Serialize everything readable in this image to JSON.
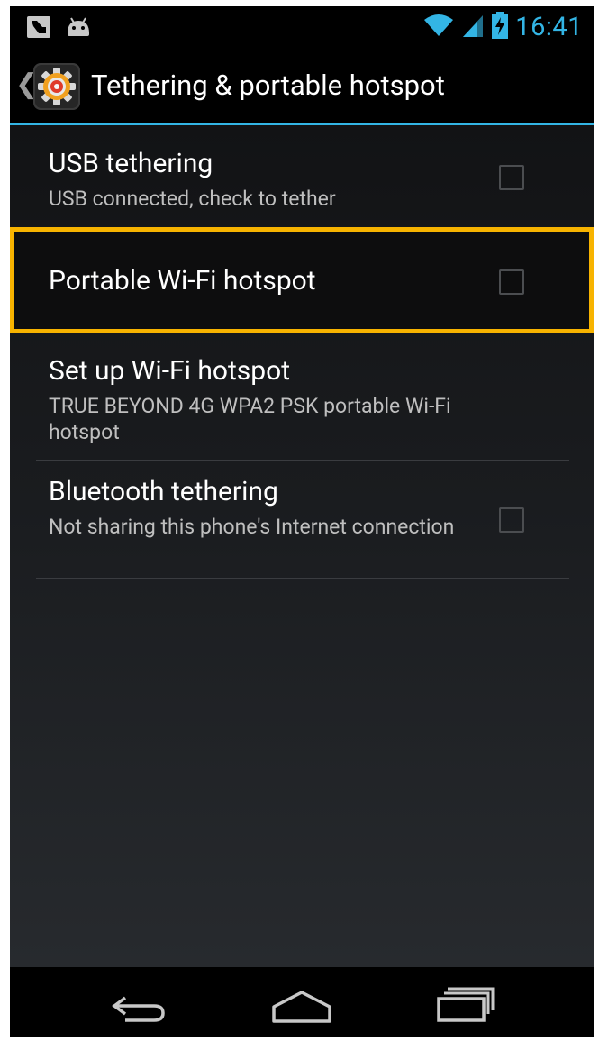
{
  "status_bar": {
    "time": "16:41",
    "icons": [
      "usb-debug-icon",
      "android-icon",
      "wifi-icon",
      "signal-icon",
      "battery-charging-icon"
    ]
  },
  "action_bar": {
    "title": "Tethering & portable hotspot",
    "up_glyph": "❮"
  },
  "preferences": [
    {
      "title": "USB tethering",
      "summary": "USB connected, check to tether",
      "checked": false
    },
    {
      "title": "Portable Wi-Fi hotspot",
      "summary": "",
      "checked": false
    },
    {
      "title": "Set up Wi-Fi hotspot",
      "summary": "TRUE BEYOND 4G WPA2 PSK portable Wi-Fi hotspot"
    },
    {
      "title": "Bluetooth tethering",
      "summary": "Not sharing this phone's Internet connection",
      "checked": false
    }
  ],
  "colors": {
    "accent": "#33b5e5",
    "highlight": "#f7b300"
  },
  "nav_bar": {
    "buttons": [
      "back-icon",
      "home-icon",
      "recents-icon"
    ]
  }
}
